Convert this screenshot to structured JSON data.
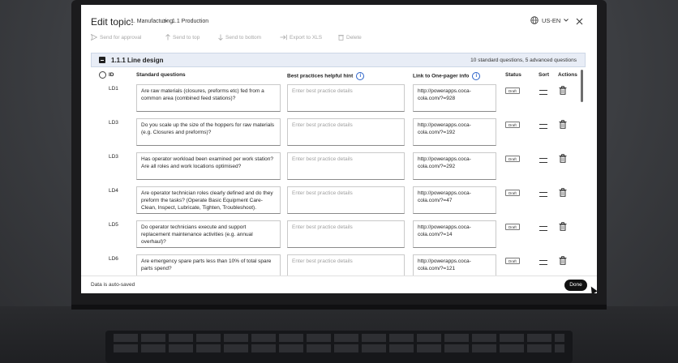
{
  "header": {
    "title": "Edit topic:",
    "crumb_1": "1. Manufacturing",
    "crumb_sep": ">",
    "crumb_2": "1.1 Production",
    "language": "US-EN"
  },
  "toolbar": {
    "send_for_approval": "Send for approval",
    "send_to_top": "Send to top",
    "send_to_bottom": "Send to bottom",
    "export": "Export to XLS",
    "delete": "Delete"
  },
  "section": {
    "title": "1.1.1 Line design",
    "count": "10 standard questions, 5 advanced questions"
  },
  "columns": {
    "id": "ID",
    "standard": "Standard questions",
    "best": "Best practices helpful hint",
    "link": "Link to One-pager info",
    "status": "Status",
    "sort": "Sort",
    "actions": "Actions"
  },
  "rows": [
    {
      "id": "LD1",
      "question": "Are raw materials (closures, preforms etc) fed from a common area (combined feed stations)?",
      "best_placeholder": "Enter best practice details",
      "link": "http://powerapps.coca-cola.com/?=928",
      "status": "Draft"
    },
    {
      "id": "LD3",
      "question": "Do you scale up the size of the hoppers for raw materials (e.g. Closures and preforms)?",
      "best_placeholder": "Enter best practice details",
      "link": "http://powerapps.coca-cola.com/?=192",
      "status": "Draft"
    },
    {
      "id": "LD3",
      "question": "Has operator workload been examined per work station? Are all roles and work locations optimised?",
      "best_placeholder": "Enter best practice details",
      "link": "http://powerapps.coca-cola.com/?=292",
      "status": "Draft"
    },
    {
      "id": "LD4",
      "question": "Are operator technician roles clearly defined and do they preform the tasks? (Operate Basic Equipment Care- Clean, Inspect, Lubricate, Tighten, Troubleshoot).",
      "best_placeholder": "Enter best practice details",
      "link": "http://powerapps.coca-cola.com/?=47",
      "status": "Draft"
    },
    {
      "id": "LD5",
      "question": "Do operator technicians execute and support replacement maintenance activities (e.g. annual overhaul)?",
      "best_placeholder": "Enter best practice details",
      "link": "http://powerapps.coca-cola.com/?=14",
      "status": "Draft"
    },
    {
      "id": "LD6",
      "question": "Are emergency spare parts less than 10% of total spare parts spend?",
      "best_placeholder": "Enter best practice details",
      "link": "http://powerapps.coca-cola.com/?=121",
      "status": "Draft"
    }
  ],
  "footer": {
    "autosave": "Data is auto-saved",
    "done": "Done"
  },
  "colors": {
    "section_bg": "#e8edf6",
    "accent_info": "#2a62c9",
    "done_bg": "#111111"
  }
}
